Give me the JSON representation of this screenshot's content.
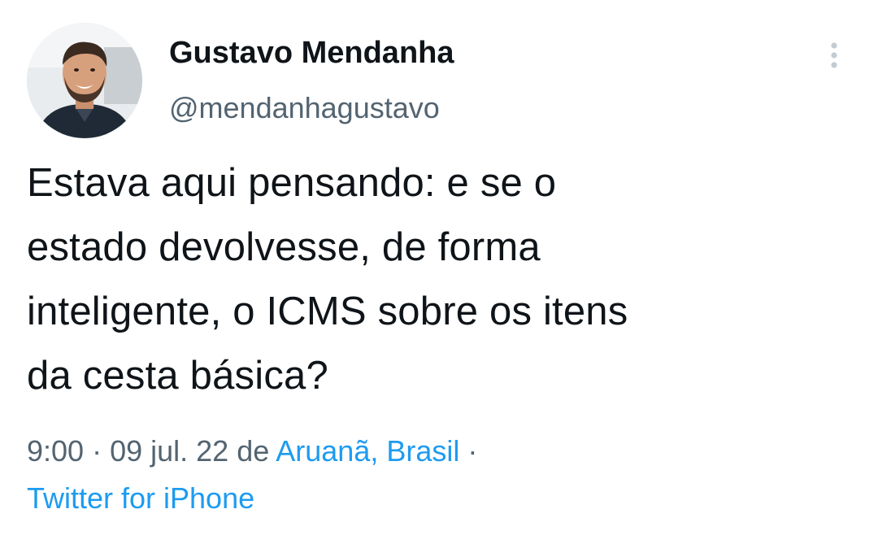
{
  "author": {
    "display_name": "Gustavo Mendanha",
    "handle": "@mendanhagustavo"
  },
  "more_icon": "more-vertical-icon",
  "tweet": {
    "lines": [
      "Estava aqui pensando: e se o",
      "estado devolvesse, de forma",
      "inteligente, o ICMS sobre os itens",
      "da cesta básica?"
    ]
  },
  "meta": {
    "time": "9:00",
    "separator": " · ",
    "date": "09 jul. 22",
    "de": " de ",
    "location": "Aruanã, Brasil",
    "trailing_separator": " ·",
    "source": "Twitter for iPhone"
  },
  "colors": {
    "text": "#0f1419",
    "secondary": "#536471",
    "link": "#1d9bf0"
  }
}
